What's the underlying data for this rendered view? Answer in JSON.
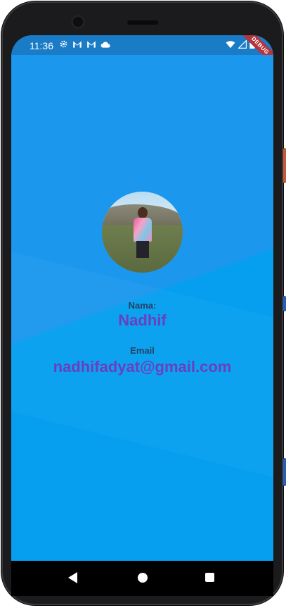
{
  "status_bar": {
    "time": "11:36",
    "icons_left": [
      "gear-icon",
      "gmail-icon",
      "gmail-icon",
      "cloud-icon"
    ],
    "icons_right": [
      "wifi-icon",
      "signal-icon",
      "battery-icon"
    ],
    "debug_banner": "DEBUG"
  },
  "profile": {
    "avatar": "profile-photo",
    "name_label": "Nama:",
    "name_value": "Nadhif",
    "email_label": "Email",
    "email_value": "nadhifadyat@gmail.com"
  },
  "nav_bar": {
    "buttons": [
      "back-icon",
      "home-icon",
      "recents-icon"
    ]
  },
  "colors": {
    "status_bar": "#1a7bc7",
    "background": "#1b97ee",
    "label": "#263f63",
    "value": "#6a3fbf",
    "nav_bar": "#000000"
  }
}
